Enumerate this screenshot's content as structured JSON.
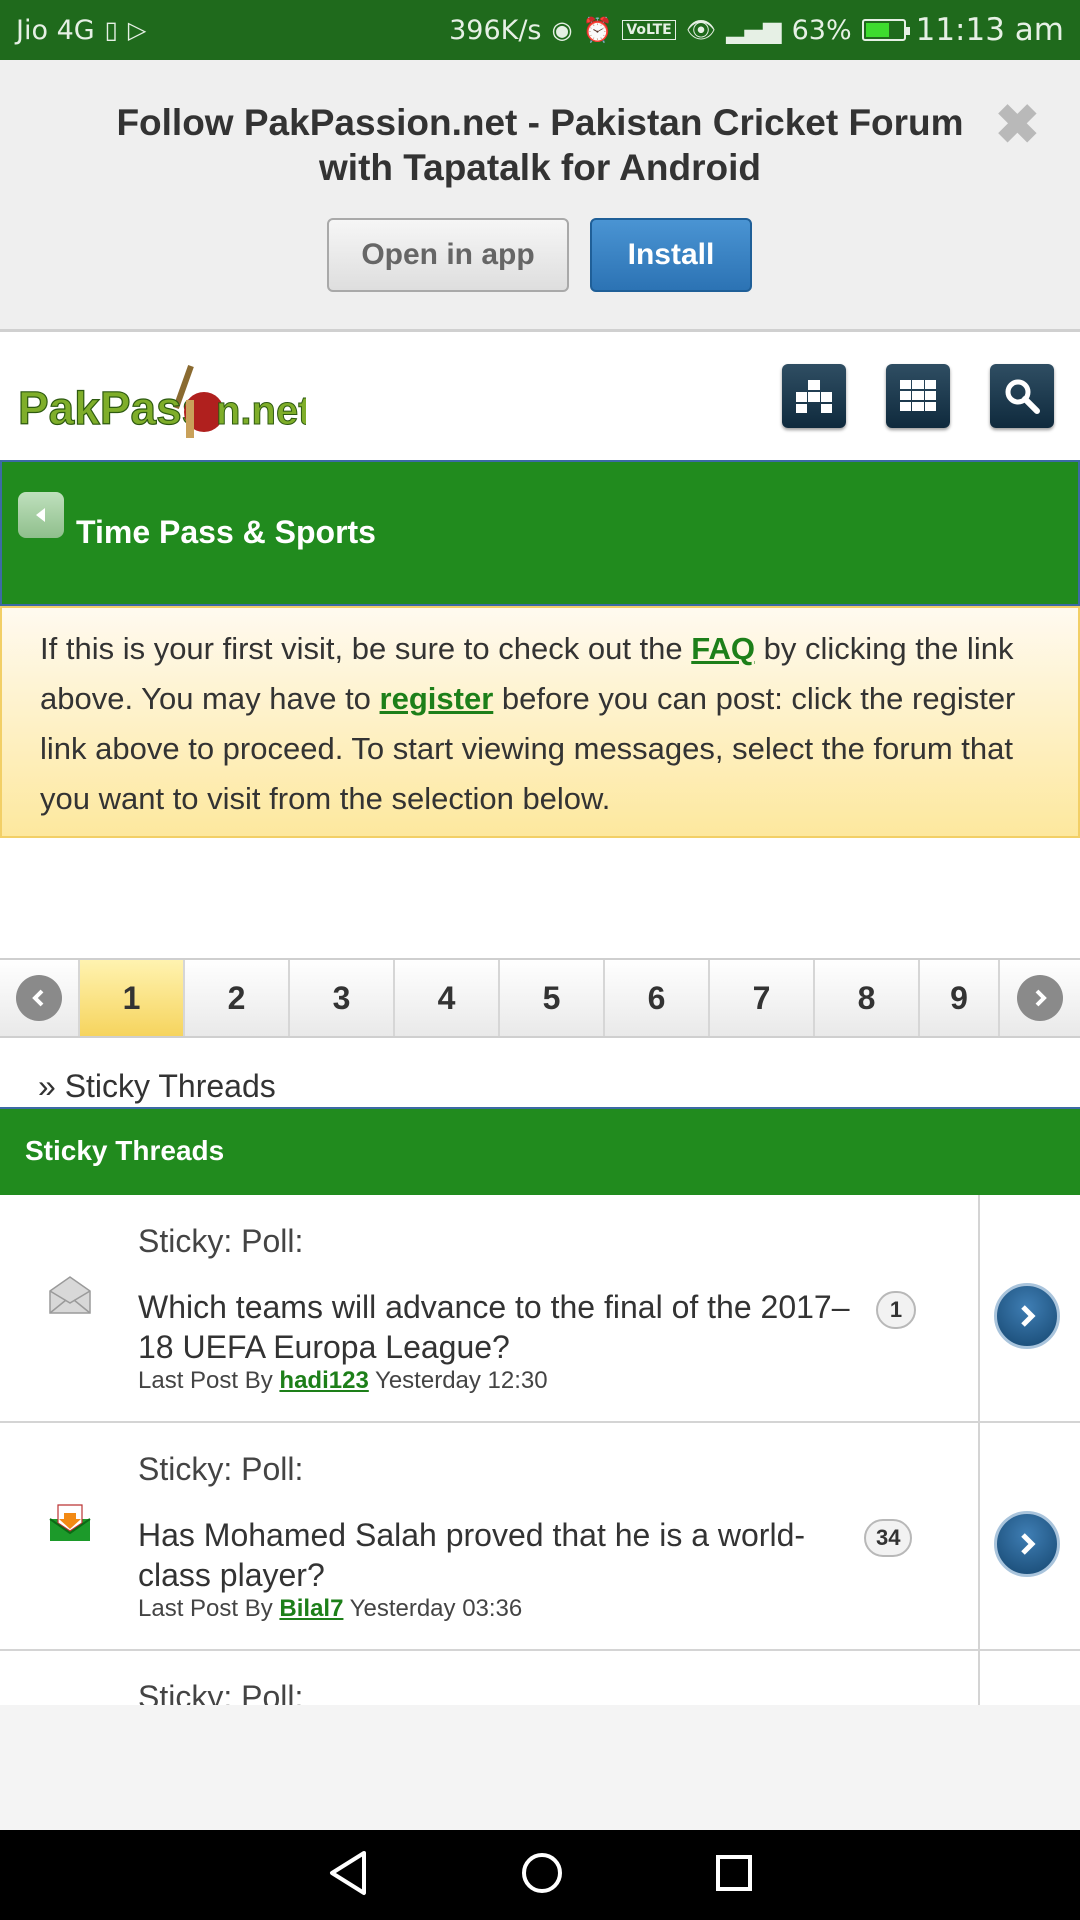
{
  "status_bar": {
    "carrier": "Jio 4G",
    "speed": "396K/s",
    "battery": "63%",
    "battery_level": 0.63,
    "time": "11:13 am"
  },
  "banner": {
    "title_line1": "Follow PakPassion.net - Pakistan Cricket Forum",
    "title_line2": "with Tapatalk for Android",
    "open_label": "Open in app",
    "install_label": "Install",
    "close_icon": "close-icon"
  },
  "header": {
    "logo_text": "PakPassion.net",
    "buttons": [
      "menu-grid-icon",
      "apps-grid-icon",
      "search-icon"
    ]
  },
  "forum": {
    "title": "Time Pass & Sports"
  },
  "notice": {
    "part1": "If this is your first visit, be sure to check out the ",
    "faq_link": "FAQ",
    "part2": " by clicking the link above. You may have to ",
    "register_link": "register",
    "part3": " before you can post: click the register link above to proceed. To start viewing messages, select the forum that you want to visit from the selection below."
  },
  "pagination": {
    "pages": [
      "1",
      "2",
      "3",
      "4",
      "5",
      "6",
      "7",
      "8",
      "9"
    ],
    "active": "1"
  },
  "breadcrumb": "» Sticky Threads",
  "section_title": "Sticky Threads",
  "threads": [
    {
      "prefix": "Sticky: Poll:",
      "title": "Which teams will advance to the final of the 2017–18 UEFA Europa League?",
      "last_post_by_label": "Last Post By",
      "user": "hadi123",
      "time": "Yesterday 12:30",
      "replies": "1",
      "icon": "envelope-read-icon"
    },
    {
      "prefix": "Sticky: Poll:",
      "title": "Has Mohamed Salah proved that he is a world-class player?",
      "last_post_by_label": "Last Post By",
      "user": "Bilal7",
      "time": "Yesterday 03:36",
      "replies": "34",
      "icon": "envelope-new-icon"
    },
    {
      "prefix": "Sticky: Poll:"
    }
  ],
  "colors": {
    "status_green": "#1f6a1c",
    "forum_green": "#218b1e",
    "link_green": "#1d7f19",
    "install_blue": "#2c73b4",
    "notice_yellow": "#fde89e",
    "active_page": "#f6d45e"
  }
}
